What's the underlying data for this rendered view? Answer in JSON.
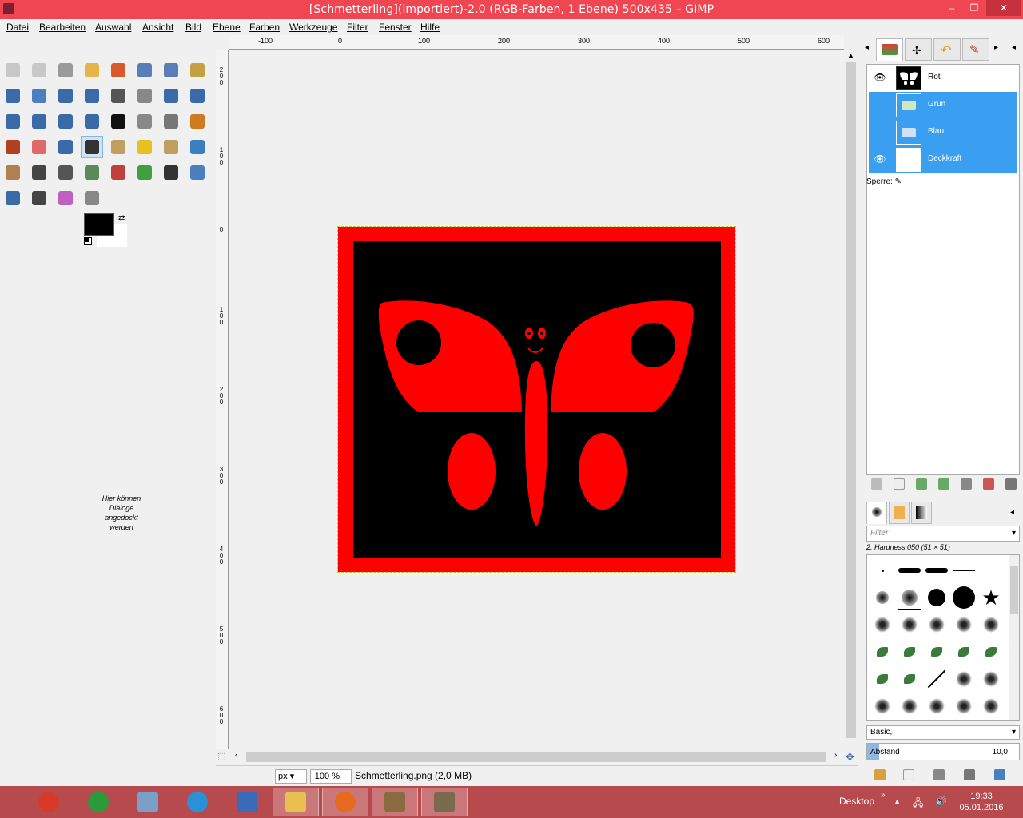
{
  "window": {
    "title": "[Schmetterling](importiert)-2.0 (RGB-Farben, 1 Ebene) 500x435 – GIMP",
    "min_glyph": "–",
    "max_glyph": "❒",
    "close_glyph": "✕"
  },
  "menu": [
    "Datei",
    "Bearbeiten",
    "Auswahl",
    "Ansicht",
    "Bild",
    "Ebene",
    "Farben",
    "Werkzeuge",
    "Filter",
    "Fenster",
    "Hilfe"
  ],
  "toolbox": {
    "tools": [
      {
        "name": "rect-select",
        "color": "#c8c8c8"
      },
      {
        "name": "ellipse-select",
        "color": "#c8c8c8"
      },
      {
        "name": "free-select",
        "color": "#9a9a9a"
      },
      {
        "name": "fuzzy-select",
        "color": "#e6b54a"
      },
      {
        "name": "color-select",
        "color": "#d85a2a"
      },
      {
        "name": "scissors",
        "color": "#5a7fb8"
      },
      {
        "name": "foreground-select",
        "color": "#5a7fb8"
      },
      {
        "name": "paths",
        "color": "#c5a040"
      },
      {
        "name": "color-picker",
        "color": "#3a6aa8"
      },
      {
        "name": "zoom",
        "color": "#4a80c0"
      },
      {
        "name": "measure",
        "color": "#3a6aa8"
      },
      {
        "name": "move",
        "color": "#3a6aa8"
      },
      {
        "name": "align",
        "color": "#555555"
      },
      {
        "name": "crop",
        "color": "#888888"
      },
      {
        "name": "rotate",
        "color": "#3a6aa8"
      },
      {
        "name": "scale",
        "color": "#3a6aa8"
      },
      {
        "name": "shear",
        "color": "#3a6aa8"
      },
      {
        "name": "perspective",
        "color": "#3a6aa8"
      },
      {
        "name": "flip",
        "color": "#3a6aa8"
      },
      {
        "name": "cage",
        "color": "#3a6aa8"
      },
      {
        "name": "text",
        "color": "#111111"
      },
      {
        "name": "bucket-fill",
        "color": "#888888"
      },
      {
        "name": "blend",
        "color": "#777777"
      },
      {
        "name": "pencil",
        "color": "#d07a20"
      },
      {
        "name": "paintbrush",
        "color": "#b04020"
      },
      {
        "name": "eraser",
        "color": "#e06a6a"
      },
      {
        "name": "airbrush",
        "color": "#3a6aa8"
      },
      {
        "name": "ink",
        "color": "#333333"
      },
      {
        "name": "clone",
        "color": "#c0a060"
      },
      {
        "name": "heal",
        "color": "#e8c020"
      },
      {
        "name": "perspective-clone",
        "color": "#c0a060"
      },
      {
        "name": "blur",
        "color": "#3a80c0"
      },
      {
        "name": "smudge",
        "color": "#b08050"
      },
      {
        "name": "dodge-burn",
        "color": "#444444"
      },
      {
        "name": "levels",
        "color": "#555555"
      },
      {
        "name": "curves",
        "color": "#5a8a5a"
      },
      {
        "name": "color-balance",
        "color": "#c04040"
      },
      {
        "name": "hue-saturation",
        "color": "#40a040"
      },
      {
        "name": "threshold",
        "color": "#333333"
      },
      {
        "name": "gimp-screenshot",
        "color": "#4a80c0"
      },
      {
        "name": "histogram",
        "color": "#3a6aa8"
      },
      {
        "name": "unsharp",
        "color": "#444444"
      },
      {
        "name": "gradient-map",
        "color": "#c060c0"
      },
      {
        "name": "spiral",
        "color": "#888888"
      }
    ],
    "dock_hint": "Hier können Dialoge angedockt werden"
  },
  "rulers": {
    "horizontal": [
      "-100",
      "0",
      "100",
      "200",
      "300",
      "400",
      "500",
      "600"
    ],
    "vertical": [
      "200",
      "100",
      "0",
      "100",
      "200",
      "300",
      "400",
      "500",
      "600"
    ]
  },
  "image": {
    "border_color": "#ff0000",
    "background_color": "#000000",
    "butterfly_color": "#ff0000"
  },
  "statusbar": {
    "unit": "px",
    "zoom": "100 %",
    "file_info": "Schmetterling.png (2,0 MB)"
  },
  "layers_dock": {
    "channels": [
      {
        "name": "Rot",
        "visible": true,
        "selected": false
      },
      {
        "name": "Grün",
        "visible": false,
        "selected": true
      },
      {
        "name": "Blau",
        "visible": false,
        "selected": true
      },
      {
        "name": "Deckkraft",
        "visible": true,
        "selected": true
      }
    ],
    "lock_label": "Sperre:",
    "eye_glyph": "👁"
  },
  "brushes_dock": {
    "filter_placeholder": "Filter",
    "selected_brush": "2. Hardness 050 (51 × 51)",
    "preset": "Basic,",
    "spacing_label": "Abstand",
    "spacing_value": "10,0"
  },
  "taskbar": {
    "apps": [
      "shutdown",
      "media-player",
      "reader",
      "internet-explorer",
      "word",
      "explorer",
      "firefox",
      "media-center",
      "gimp"
    ],
    "tray_label": "Desktop",
    "time": "19:33",
    "date": "05.01.2016"
  }
}
